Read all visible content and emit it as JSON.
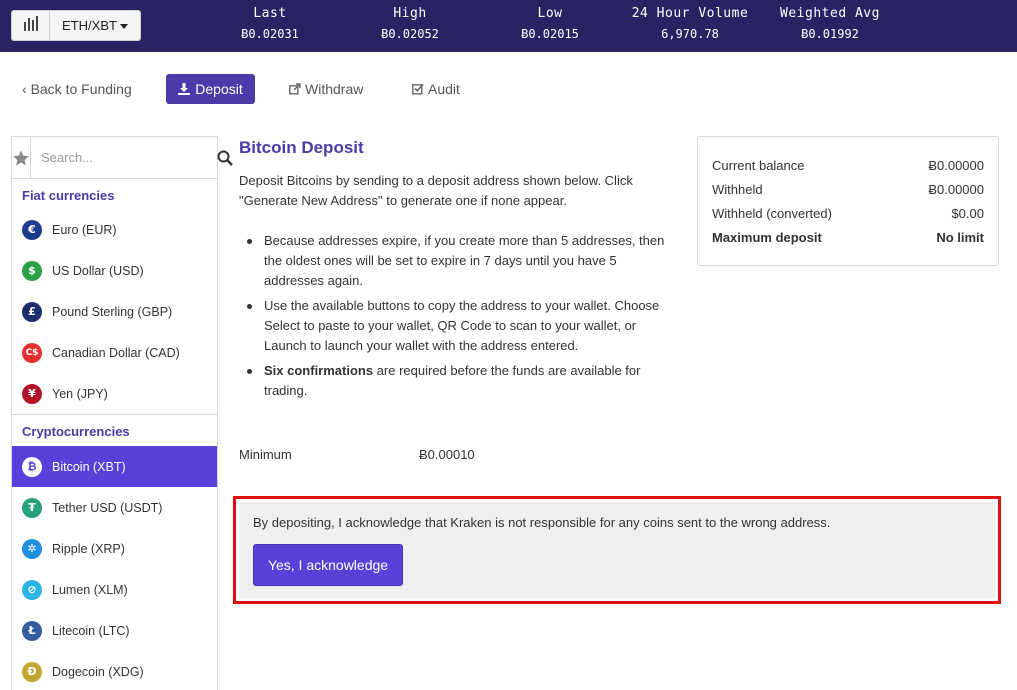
{
  "topbar": {
    "pair": "ETH/XBT",
    "ticker": [
      {
        "label": "Last",
        "value": "Ƀ0.02031"
      },
      {
        "label": "High",
        "value": "Ƀ0.02052"
      },
      {
        "label": "Low",
        "value": "Ƀ0.02015"
      },
      {
        "label": "24 Hour Volume",
        "value": "6,970.78"
      },
      {
        "label": "Weighted Avg",
        "value": "Ƀ0.01992"
      }
    ]
  },
  "subnav": {
    "back": "Back to Funding",
    "deposit": "Deposit",
    "withdraw": "Withdraw",
    "audit": "Audit"
  },
  "sidebar": {
    "search_placeholder": "Search...",
    "fiat_header": "Fiat currencies",
    "fiat": [
      {
        "label": "Euro (EUR)",
        "glyph": "€",
        "color": "#1d3b8f"
      },
      {
        "label": "US Dollar (USD)",
        "glyph": "$",
        "color": "#27a047"
      },
      {
        "label": "Pound Sterling (GBP)",
        "glyph": "£",
        "color": "#1d2f6f"
      },
      {
        "label": "Canadian Dollar (CAD)",
        "glyph": "C$",
        "color": "#e53030"
      },
      {
        "label": "Yen (JPY)",
        "glyph": "¥",
        "color": "#b3132a"
      }
    ],
    "crypto_header": "Cryptocurrencies",
    "crypto": [
      {
        "label": "Bitcoin (XBT)",
        "glyph": "₿",
        "color": "#ffffff",
        "active": true
      },
      {
        "label": "Tether USD (USDT)",
        "glyph": "₮",
        "color": "#26a17b"
      },
      {
        "label": "Ripple (XRP)",
        "glyph": "✲",
        "color": "#1f8fe0"
      },
      {
        "label": "Lumen (XLM)",
        "glyph": "⊘",
        "color": "#2bb5e6"
      },
      {
        "label": "Litecoin (LTC)",
        "glyph": "Ł",
        "color": "#345d9d"
      },
      {
        "label": "Dogecoin (XDG)",
        "glyph": "Ð",
        "color": "#c2a633"
      }
    ]
  },
  "main": {
    "title": "Bitcoin Deposit",
    "intro": "Deposit Bitcoins by sending to a deposit address shown below. Click \"Generate New Address\" to generate one if none appear.",
    "bullet1": "Because addresses expire, if you create more than 5 addresses, then the oldest ones will be set to expire in 7 days until you have 5 addresses again.",
    "bullet2": "Use the available buttons to copy the address to your wallet. Choose Select to paste to your wallet, QR Code to scan to your wallet, or Launch to launch your wallet with the address entered.",
    "bullet3_bold": "Six confirmations",
    "bullet3_rest": " are required before the funds are available for trading.",
    "minimum_label": "Minimum",
    "minimum_value": "Ƀ0.00010"
  },
  "balance": {
    "rows": [
      {
        "label": "Current balance",
        "value": "Ƀ0.00000"
      },
      {
        "label": "Withheld",
        "value": "Ƀ0.00000"
      },
      {
        "label": "Withheld (converted)",
        "value": "$0.00"
      },
      {
        "label": "Maximum deposit",
        "value": "No limit"
      }
    ]
  },
  "acknowledge": {
    "text": "By depositing, I acknowledge that Kraken is not responsible for any coins sent to the wrong address.",
    "button": "Yes, I acknowledge"
  }
}
